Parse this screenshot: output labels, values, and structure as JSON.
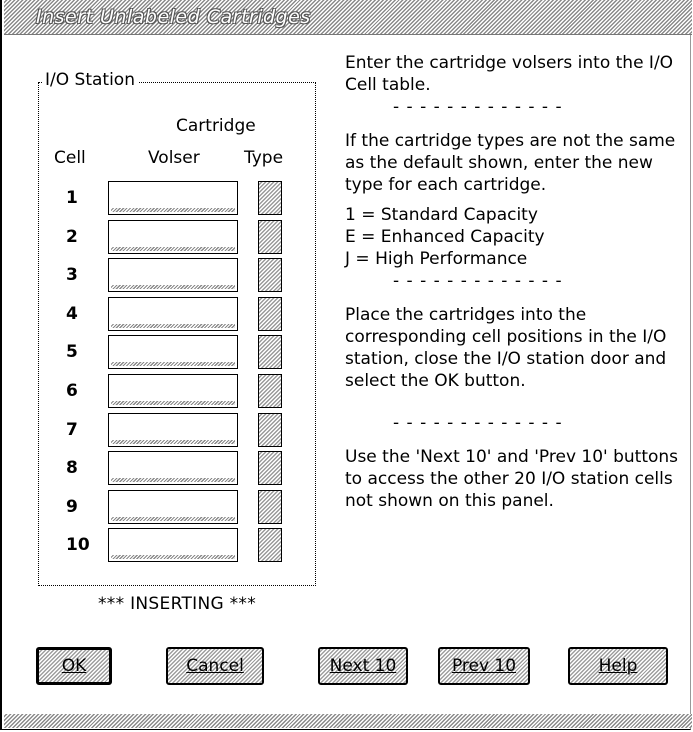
{
  "window": {
    "title": "Insert Unlabeled Cartridges"
  },
  "io_station": {
    "legend": "I/O Station",
    "header_cartridge": "Cartridge",
    "header_cell": "Cell",
    "header_volser": "Volser",
    "header_type": "Type",
    "rows": [
      {
        "cell": "1",
        "volser": "",
        "type": ""
      },
      {
        "cell": "2",
        "volser": "",
        "type": ""
      },
      {
        "cell": "3",
        "volser": "",
        "type": ""
      },
      {
        "cell": "4",
        "volser": "",
        "type": ""
      },
      {
        "cell": "5",
        "volser": "",
        "type": ""
      },
      {
        "cell": "6",
        "volser": "",
        "type": ""
      },
      {
        "cell": "7",
        "volser": "",
        "type": ""
      },
      {
        "cell": "8",
        "volser": "",
        "type": ""
      },
      {
        "cell": "9",
        "volser": "",
        "type": ""
      },
      {
        "cell": "10",
        "volser": "",
        "type": ""
      }
    ]
  },
  "status": "*** INSERTING ***",
  "help": {
    "p1": "Enter the cartridge volsers into the I/O Cell table.",
    "sep": "- - - - - - - - - - - - -",
    "p2": "If the cartridge types are not the same as the default shown, enter the new type for each cartridge.",
    "type1": "1 = Standard Capacity",
    "typeE": "E = Enhanced Capacity",
    "typeJ": "J = High Performance",
    "p3": "Place the cartridges into the corresponding cell positions in the I/O station, close the I/O station door and select the OK button.",
    "p4": "Use the 'Next 10' and 'Prev 10' buttons to access the other 20 I/O station cells not shown on this panel."
  },
  "buttons": {
    "ok": "OK",
    "cancel": "Cancel",
    "next": "Next 10",
    "prev": "Prev 10",
    "help": "Help"
  }
}
